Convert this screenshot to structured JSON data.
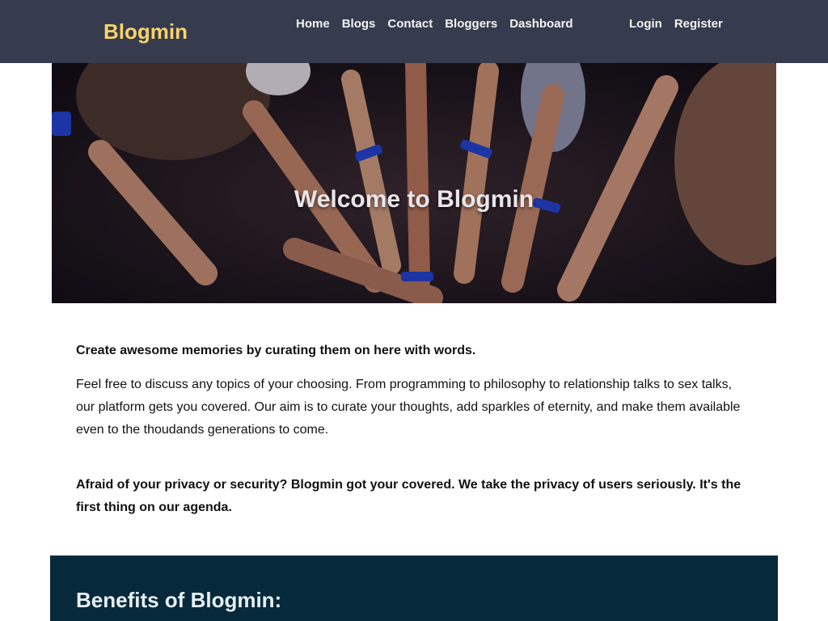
{
  "nav": {
    "brand": "Blogmin",
    "links": [
      "Home",
      "Blogs",
      "Contact",
      "Bloggers",
      "Dashboard"
    ],
    "auth": [
      "Login",
      "Register"
    ]
  },
  "hero": {
    "title": "Welcome to Blogmin",
    "image_desc": "hands-together-photo"
  },
  "content": {
    "lead": "Create awesome memories by curating them on here with words.",
    "paragraph": "Feel free to discuss any topics of your choosing. From programming to philosophy to relationship talks to sex talks, our platform gets you covered. Our aim is to curate your thoughts, add sparkles of eternity, and make them available even to the thoudands generations to come.",
    "privacy": "Afraid of your privacy or security? Blogmin got your covered. We take the privacy of users seriously. It's the first thing on our agenda."
  },
  "benefits": {
    "title": "Benefits of Blogmin:"
  },
  "colors": {
    "navbar": "#363c4d",
    "brand": "#f6d36b",
    "benefits_bg": "#062a3c"
  }
}
